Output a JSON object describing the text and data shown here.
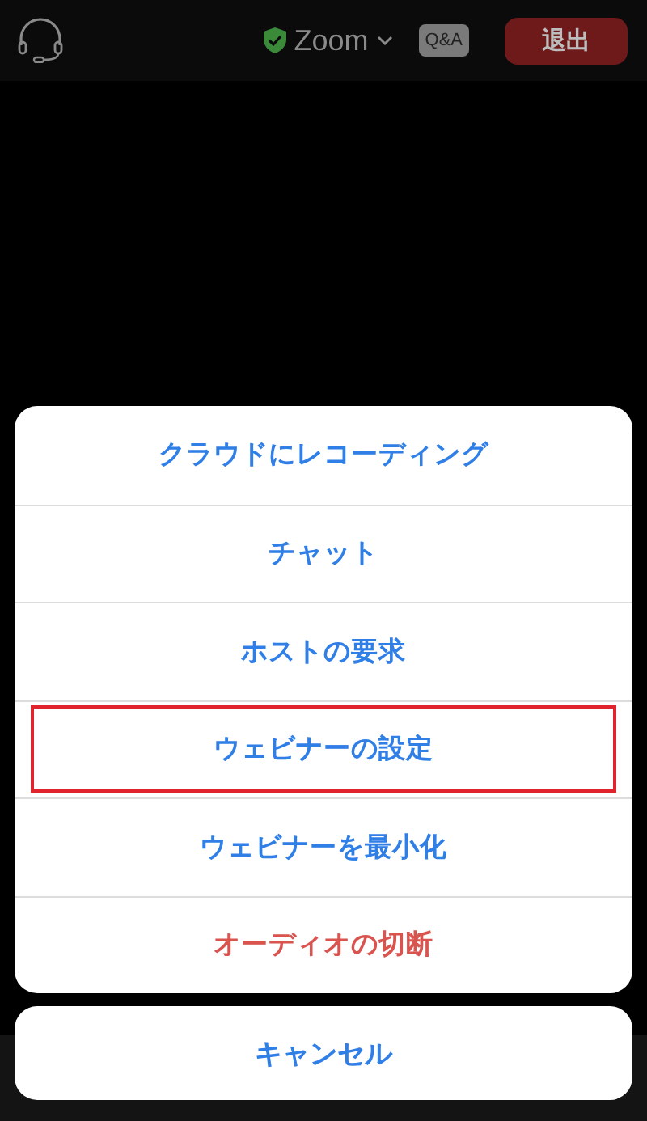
{
  "top_bar": {
    "title": "Zoom",
    "qa_badge": "Q&A",
    "leave_button": "退出"
  },
  "action_sheet": {
    "items": [
      {
        "label": "クラウドにレコーディング",
        "kind": "default",
        "highlighted": false
      },
      {
        "label": "チャット",
        "kind": "default",
        "highlighted": false
      },
      {
        "label": "ホストの要求",
        "kind": "default",
        "highlighted": false
      },
      {
        "label": "ウェビナーの設定",
        "kind": "default",
        "highlighted": true
      },
      {
        "label": "ウェビナーを最小化",
        "kind": "default",
        "highlighted": false
      },
      {
        "label": "オーディオの切断",
        "kind": "destructive",
        "highlighted": false
      }
    ],
    "cancel": "キャンセル"
  }
}
